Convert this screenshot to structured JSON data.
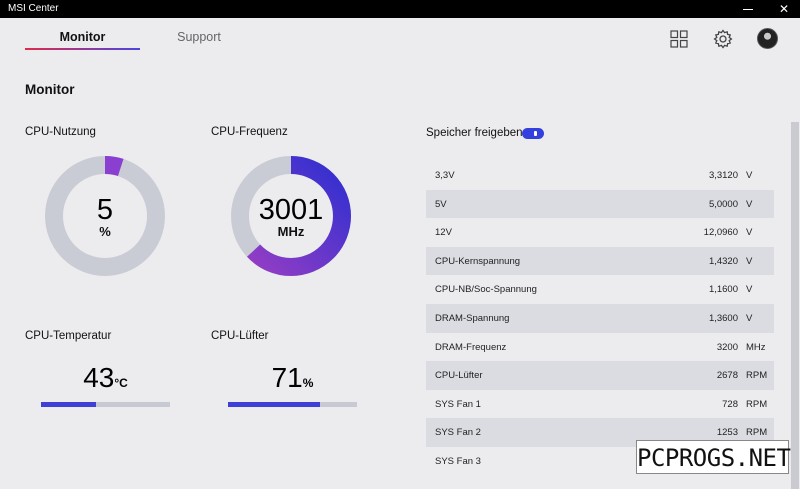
{
  "window": {
    "title": "MSI Center",
    "minimize_glyph": "—",
    "close_glyph": "✕"
  },
  "nav": {
    "tabs": [
      {
        "label": "Monitor",
        "active": true
      },
      {
        "label": "Support",
        "active": false
      }
    ]
  },
  "header_icons": [
    "grid-icon",
    "gear-icon",
    "avatar"
  ],
  "page": {
    "title": "Monitor"
  },
  "cpu_usage": {
    "title": "CPU-Nutzung",
    "value": "5",
    "unit": "%",
    "fraction": 0.05
  },
  "cpu_freq": {
    "title": "CPU-Frequenz",
    "value": "3001",
    "unit": "MHz",
    "fraction": 0.63
  },
  "cpu_temp": {
    "title": "CPU-Temperatur",
    "value": "43",
    "unit": "°C",
    "fraction": 0.43
  },
  "cpu_fan": {
    "title": "CPU-Lüfter",
    "value": "71",
    "unit": "%",
    "fraction": 0.71
  },
  "memory": {
    "title": "Speicher freigeben"
  },
  "voltages": [
    {
      "label": "3,3V",
      "value": "3,3120",
      "unit": "V"
    },
    {
      "label": "5V",
      "value": "5,0000",
      "unit": "V"
    },
    {
      "label": "12V",
      "value": "12,0960",
      "unit": "V"
    },
    {
      "label": "CPU-Kernspannung",
      "value": "1,4320",
      "unit": "V"
    },
    {
      "label": "CPU-NB/Soc-Spannung",
      "value": "1,1600",
      "unit": "V"
    },
    {
      "label": "DRAM-Spannung",
      "value": "1,3600",
      "unit": "V"
    },
    {
      "label": "DRAM-Frequenz",
      "value": "3200",
      "unit": "MHz"
    },
    {
      "label": "CPU-Lüfter",
      "value": "2678",
      "unit": "RPM"
    },
    {
      "label": "SYS Fan 1",
      "value": "728",
      "unit": "RPM"
    },
    {
      "label": "SYS Fan 2",
      "value": "1253",
      "unit": "RPM"
    },
    {
      "label": "SYS Fan 3",
      "value": "",
      "unit": ""
    }
  ],
  "watermark": {
    "text": "PCPROGS.NET"
  },
  "colors": {
    "accent": "#3f3fd8",
    "track": "#c9ccd4",
    "gauge_start": "#9a3ec4",
    "gauge_end": "#2f2fd0",
    "tab_underline_start": "#e02a4a",
    "tab_underline_end": "#4a46e0"
  }
}
